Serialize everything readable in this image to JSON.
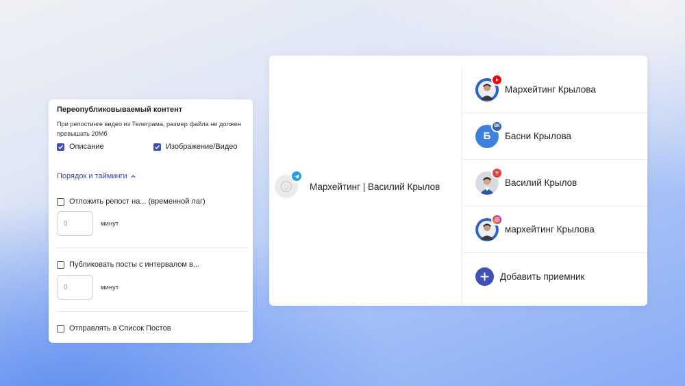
{
  "settings": {
    "title": "Переопубликовываемый контент",
    "note": "При репостинге видео из Телеграма, размер файла не должен превышать 20Мб",
    "options": [
      {
        "label": "Описание",
        "checked": true
      },
      {
        "label": "Изображение/Видео",
        "checked": true
      }
    ],
    "order_toggle_label": "Порядок и тайминги",
    "delay": {
      "label": "Отложить репост на... (временной лаг)",
      "checked": false,
      "placeholder": "0",
      "unit": "минут"
    },
    "interval": {
      "label": "Публиковать посты с интервалом в...",
      "checked": false,
      "placeholder": "0",
      "unit": "минут"
    },
    "post_list": {
      "label": "Отправлять в Список Постов",
      "checked": false
    }
  },
  "routing": {
    "source": {
      "name": "Мархейтинг | Василий Крылов",
      "icon": "telegram-icon"
    },
    "destinations": [
      {
        "name": "Мархейтинг Крылова",
        "icon": "youtube-icon",
        "badge_color": "#ff0000"
      },
      {
        "name": "Басни Крылова",
        "icon": "vk-icon",
        "avatar_letter": "Б",
        "badge_color": "#2f62b8"
      },
      {
        "name": "Василий Крылов",
        "icon": "tenchat-icon",
        "badge_color": "#e83d3d"
      },
      {
        "name": "мархейтинг Крылова",
        "icon": "instagram-icon",
        "badge_color": "#d6287a"
      }
    ],
    "add_label": "Добавить приемник"
  },
  "colors": {
    "accent": "#3f51b5",
    "link": "#3949ab",
    "telegram": "#2a9ee0"
  }
}
